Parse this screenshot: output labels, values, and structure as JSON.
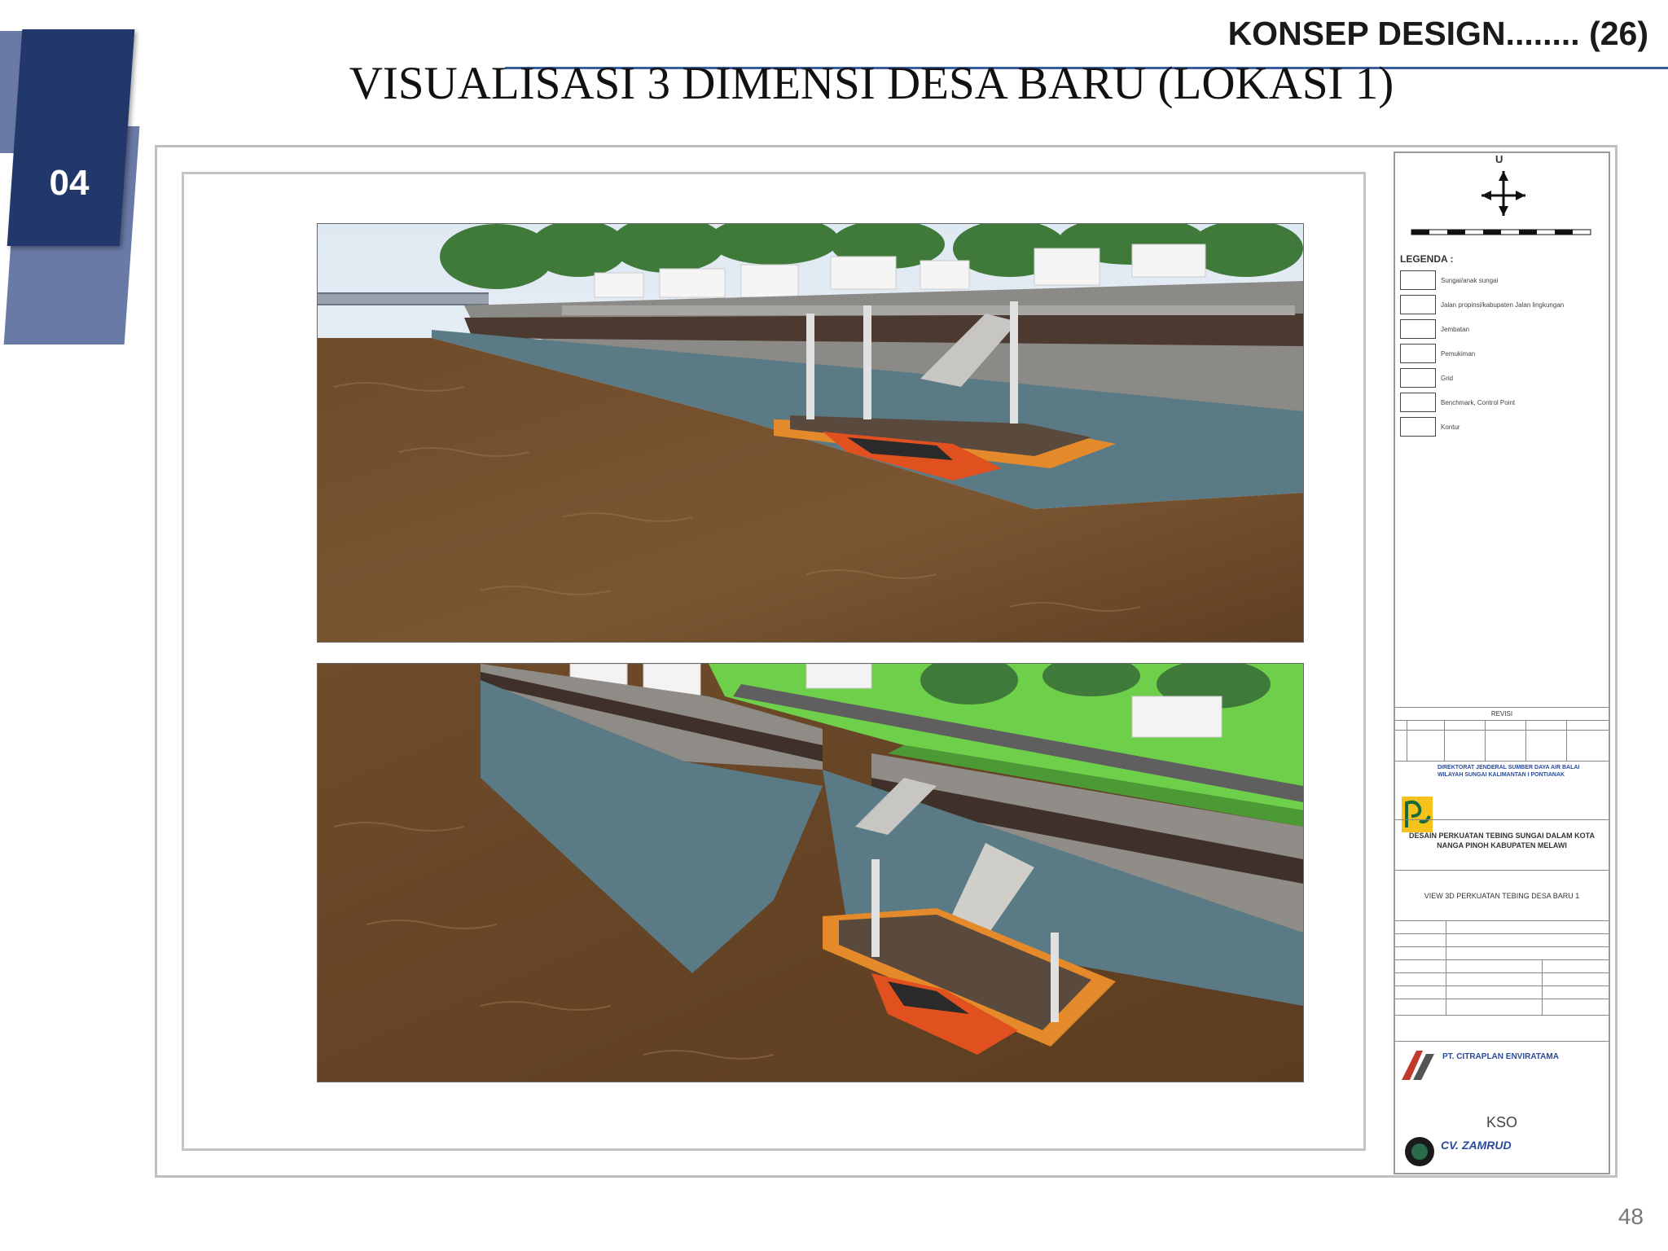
{
  "header": {
    "section_label": "KONSEP DESIGN........ (26)"
  },
  "badge": {
    "number": "04"
  },
  "title": {
    "text": "VISUALISASI 3 DIMENSI DESA BARU (LOKASI 1)"
  },
  "page_number": "48",
  "title_block": {
    "north_label": "U",
    "legend_title": "LEGENDA :",
    "legend_items": [
      "Sungai/anak sungai",
      "Jalan propinsi/kabupaten Jalan lingkungan",
      "Jembatan",
      "Pemukiman",
      "Grid",
      "Benchmark, Control Point",
      "Kontur"
    ],
    "revisi_label": "REVISI",
    "agency": "DIREKTORAT JENDERAL SUMBER DAYA AIR BALAI WILAYAH SUNGAI KALIMANTAN I PONTIANAK",
    "project": "DESAIN PERKUATAN TEBING SUNGAI DALAM KOTA NANGA PINOH KABUPATEN MELAWI",
    "drawing_title": "VIEW 3D PERKUATAN TEBING DESA BARU 1",
    "consultant": "PT. CITRAPLAN ENVIRATAMA",
    "kso": "KSO",
    "partner": "CV. ZAMRUD"
  },
  "colors": {
    "badge_dark": "#22376a",
    "badge_light": "#6a7aa6",
    "accent_rule": "#3a5ca0",
    "river": "#6b4b2a",
    "grass": "#6ecf4a"
  }
}
